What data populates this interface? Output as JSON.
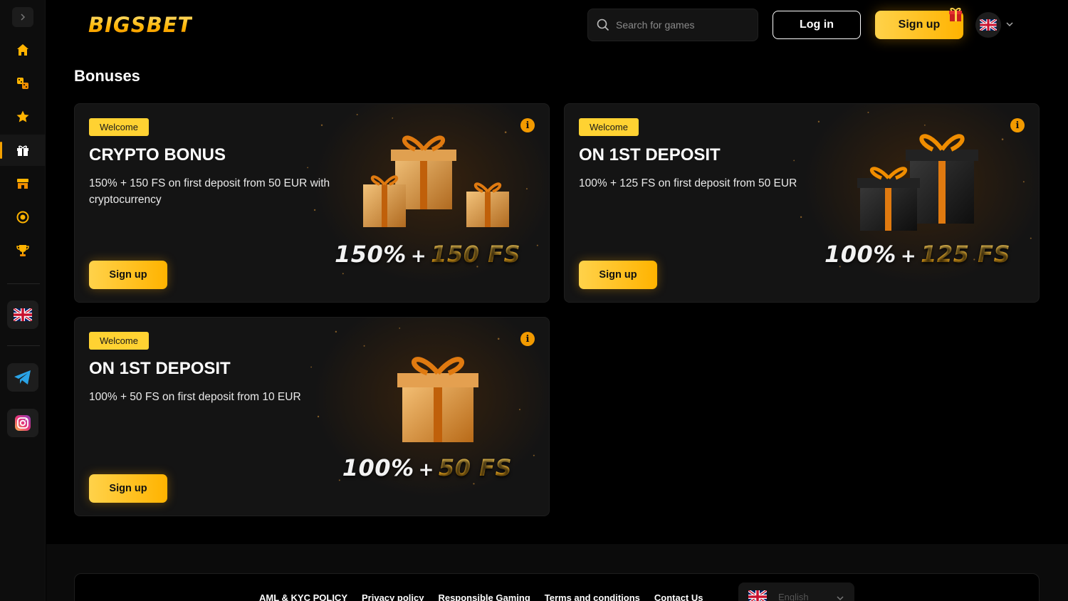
{
  "header": {
    "logo": "BIGSBET",
    "search_placeholder": "Search for games",
    "login_label": "Log in",
    "signup_label": "Sign up",
    "language_flag": "uk-flag-icon"
  },
  "sidebar": {
    "items": [
      {
        "icon": "home-icon"
      },
      {
        "icon": "dice-icon"
      },
      {
        "icon": "star-icon"
      },
      {
        "icon": "gift-icon",
        "active": true
      },
      {
        "icon": "shop-icon"
      },
      {
        "icon": "coin-icon"
      },
      {
        "icon": "trophy-icon"
      }
    ],
    "language_flag": "uk-flag-icon",
    "socials": [
      "telegram-icon",
      "instagram-icon"
    ]
  },
  "page": {
    "title": "Bonuses"
  },
  "bonuses": [
    {
      "badge": "Welcome",
      "title": "CRYPTO BONUS",
      "description": "150% + 150 FS on first deposit from 50 EUR with cryptocurrency",
      "button": "Sign up",
      "promo_percent": "150%",
      "promo_plus": "+",
      "promo_fs": "150 FS"
    },
    {
      "badge": "Welcome",
      "title": "ON 1ST DEPOSIT",
      "description": "100% + 125 FS on first deposit from 50 EUR",
      "button": "Sign up",
      "promo_percent": "100%",
      "promo_plus": "+",
      "promo_fs": "125 FS"
    },
    {
      "badge": "Welcome",
      "title": "ON 1ST DEPOSIT",
      "description": "100% + 50 FS on first deposit from 10 EUR",
      "button": "Sign up",
      "promo_percent": "100%",
      "promo_plus": "+",
      "promo_fs": "50 FS"
    }
  ],
  "footer": {
    "links": [
      "AML & KYC POLICY",
      "Privacy policy",
      "Responsible Gaming",
      "Terms and conditions",
      "Contact Us"
    ],
    "language": "English"
  },
  "colors": {
    "accent": "#ffb300",
    "accent_light": "#ffd24a",
    "background": "#000000",
    "card": "#141414"
  }
}
